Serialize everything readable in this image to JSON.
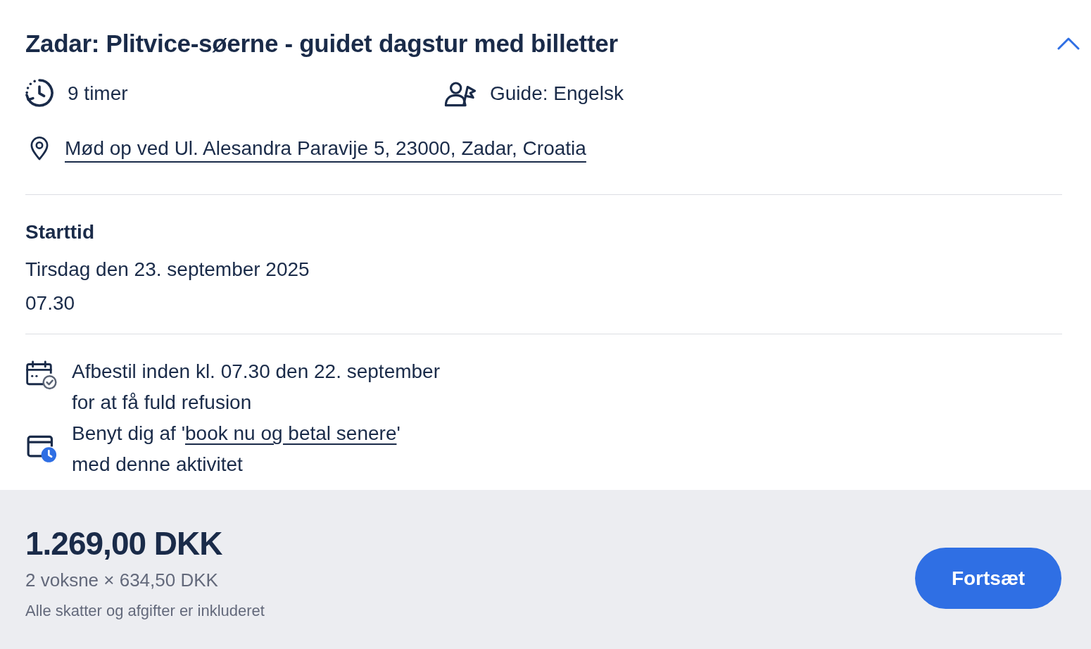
{
  "header": {
    "title": "Zadar: Plitvice-søerne - guidet dagstur med billetter",
    "expanded": true
  },
  "details": [
    {
      "kind": "duration",
      "text": "9 timer"
    },
    {
      "kind": "guide",
      "text": "Guide: Engelsk"
    }
  ],
  "meeting_point": {
    "text": "Mød op ved Ul. Alesandra Paravije 5, 23000, Zadar, Croatia"
  },
  "start_time": {
    "heading": "Starttid",
    "date": "Tirsdag den 23. september 2025",
    "time": "07.30"
  },
  "policies": [
    {
      "kind": "cancellation",
      "lines": [
        "Afbestil inden kl. 07.30 den 22. september",
        "for at få fuld refusion"
      ]
    },
    {
      "kind": "pay_later",
      "before": "Benyt dig af '",
      "link": "book nu og betal senere",
      "after": "'",
      "line_2": "med denne aktivitet"
    }
  ],
  "footer": {
    "total": "1.269,00 DKK",
    "breakdown": "2 voksne × 634,50 DKK",
    "note": "Alle skatter og afgifter er inkluderet",
    "button": "Fortsæt"
  }
}
